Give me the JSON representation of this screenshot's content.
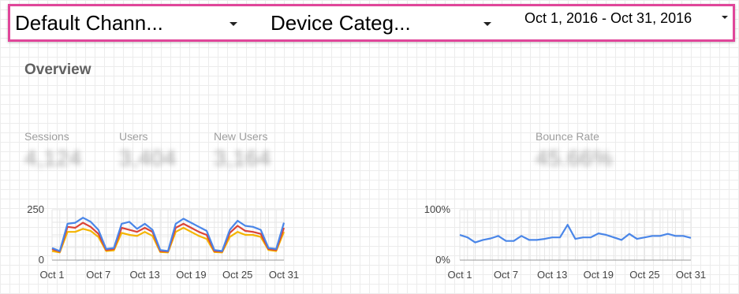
{
  "filters": {
    "channel": {
      "label": "Default Chann..."
    },
    "device": {
      "label": "Device Categ..."
    },
    "date_range": {
      "label": "Oct 1, 2016 - Oct 31, 2016"
    }
  },
  "page_title": "Overview",
  "metrics": [
    {
      "label": "Sessions",
      "value": "4,124"
    },
    {
      "label": "Users",
      "value": "3,404"
    },
    {
      "label": "New Users",
      "value": "3,164"
    },
    {
      "label": "Bounce Rate",
      "value": "45.66%"
    }
  ],
  "chart_data": [
    {
      "type": "line",
      "x": [
        "Oct 1",
        "Oct 2",
        "Oct 3",
        "Oct 4",
        "Oct 5",
        "Oct 6",
        "Oct 7",
        "Oct 8",
        "Oct 9",
        "Oct 10",
        "Oct 11",
        "Oct 12",
        "Oct 13",
        "Oct 14",
        "Oct 15",
        "Oct 16",
        "Oct 17",
        "Oct 18",
        "Oct 19",
        "Oct 20",
        "Oct 21",
        "Oct 22",
        "Oct 23",
        "Oct 24",
        "Oct 25",
        "Oct 26",
        "Oct 27",
        "Oct 28",
        "Oct 29",
        "Oct 30",
        "Oct 31"
      ],
      "x_tick_labels": [
        "Oct 1",
        "Oct 7",
        "Oct 13",
        "Oct 19",
        "Oct 25",
        "Oct 31"
      ],
      "y_tick_labels": [
        "250",
        "0"
      ],
      "ylim": [
        0,
        250
      ],
      "grid": true,
      "series": [
        {
          "color": "#4a86e8",
          "values": [
            60,
            45,
            180,
            185,
            210,
            190,
            150,
            55,
            60,
            180,
            190,
            155,
            180,
            150,
            50,
            45,
            180,
            205,
            185,
            165,
            145,
            50,
            45,
            150,
            195,
            170,
            165,
            150,
            60,
            55,
            185
          ]
        },
        {
          "color": "#db4437",
          "values": [
            55,
            42,
            165,
            160,
            185,
            165,
            130,
            50,
            55,
            160,
            150,
            140,
            160,
            140,
            45,
            42,
            160,
            180,
            160,
            140,
            125,
            45,
            42,
            135,
            170,
            145,
            140,
            130,
            55,
            50,
            160
          ]
        },
        {
          "color": "#f4b400",
          "values": [
            45,
            38,
            140,
            140,
            155,
            145,
            115,
            45,
            48,
            135,
            125,
            120,
            140,
            120,
            40,
            38,
            140,
            160,
            140,
            120,
            105,
            40,
            38,
            115,
            140,
            125,
            125,
            115,
            50,
            45,
            140
          ]
        }
      ]
    },
    {
      "type": "line",
      "x": [
        "Oct 1",
        "Oct 2",
        "Oct 3",
        "Oct 4",
        "Oct 5",
        "Oct 6",
        "Oct 7",
        "Oct 8",
        "Oct 9",
        "Oct 10",
        "Oct 11",
        "Oct 12",
        "Oct 13",
        "Oct 14",
        "Oct 15",
        "Oct 16",
        "Oct 17",
        "Oct 18",
        "Oct 19",
        "Oct 20",
        "Oct 21",
        "Oct 22",
        "Oct 23",
        "Oct 24",
        "Oct 25",
        "Oct 26",
        "Oct 27",
        "Oct 28",
        "Oct 29",
        "Oct 30",
        "Oct 31"
      ],
      "x_tick_labels": [
        "Oct 1",
        "Oct 7",
        "Oct 13",
        "Oct 19",
        "Oct 25",
        "Oct 31"
      ],
      "y_tick_labels": [
        "100%",
        "0%"
      ],
      "ylim": [
        0,
        100
      ],
      "grid": true,
      "series": [
        {
          "color": "#4a86e8",
          "values": [
            50,
            45,
            35,
            40,
            43,
            48,
            38,
            38,
            48,
            40,
            40,
            42,
            45,
            45,
            70,
            42,
            45,
            45,
            53,
            50,
            45,
            40,
            52,
            42,
            45,
            48,
            48,
            52,
            48,
            48,
            44
          ]
        }
      ]
    }
  ]
}
